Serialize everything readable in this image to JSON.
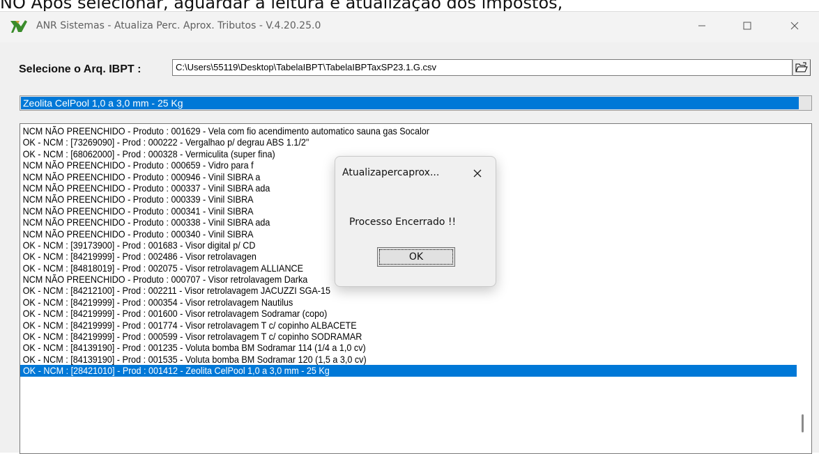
{
  "caption": "NO Após selecionar, aguardar a leitura e atualização dos impostos,",
  "window": {
    "title": "ANR Sistemas - Atualiza Perc. Aprox. Tributos - V.4.20.25.0",
    "minimize_icon": "minimize-icon",
    "maximize_icon": "maximize-icon",
    "close_icon": "close-icon"
  },
  "form": {
    "select_label": "Selecione o Arq. IBPT :",
    "path_value": "C:\\Users\\55119\\Desktop\\TabelaIBPT\\TabelaIBPTaxSP23.1.G.csv",
    "browse_icon": "folder-open-icon"
  },
  "progress": {
    "text": "Zeolita CelPool 1,0 a 3,0 mm - 25 Kg",
    "fraction": 0.985,
    "color": "#0078d7"
  },
  "log": {
    "items": [
      "NCM NÃO PREENCHIDO - Produto : 001629 - Vela com fio acendimento automatico sauna gas Socalor",
      "OK - NCM : [73269090] - Prod : 000222 - Vergalhao p/ degrau ABS 1.1/2\"",
      "OK - NCM : [68062000] - Prod : 000328 - Vermiculita (super fina)",
      "NCM NÃO PREENCHIDO - Produto : 000659 - Vidro para f",
      "NCM NÃO PREENCHIDO - Produto : 000946 - Vinil SIBRA                                                   a",
      "NCM NÃO PREENCHIDO - Produto : 000337 - Vinil SIBRA                                                   ada",
      "NCM NÃO PREENCHIDO - Produto : 000339 - Vinil SIBRA",
      "NCM NÃO PREENCHIDO - Produto : 000341 - Vinil SIBRA",
      "NCM NÃO PREENCHIDO - Produto : 000338 - Vinil SIBRA                                                   ada",
      "NCM NÃO PREENCHIDO - Produto : 000340 - Vinil SIBRA",
      "OK - NCM : [39173900] - Prod : 001683 - Visor digital p/ CD",
      "OK - NCM : [84219999] - Prod : 002486 - Visor retrolavagen",
      "OK - NCM : [84818019] - Prod : 002075 - Visor retrolavagem ALLIANCE",
      "NCM NÃO PREENCHIDO - Produto : 000707 - Visor retrolavagem Darka",
      "OK - NCM : [84212100] - Prod : 002211 - Visor retrolavagem JACUZZI SGA-15",
      "OK - NCM : [84219999] - Prod : 000354 - Visor retrolavagem Nautilus",
      "OK - NCM : [84219999] - Prod : 001600 - Visor retrolavagem Sodramar (copo)",
      "OK - NCM : [84219999] - Prod : 001774 - Visor retrolavagem T c/ copinho ALBACETE",
      "OK - NCM : [84219999] - Prod : 000599 - Visor retrolavagem T c/ copinho SODRAMAR",
      "OK - NCM : [84139190] - Prod : 001235 - Voluta bomba BM Sodramar 114 (1/4 a 1,0 cv)",
      "OK - NCM : [84139190] - Prod : 001535 - Voluta bomba BM Sodramar 120 (1,5 a 3,0 cv)",
      "OK - NCM : [28421010] - Prod : 001412 - Zeolita CelPool 1,0 a 3,0 mm - 25 Kg"
    ],
    "selected_color": "#0078d7"
  },
  "dialog": {
    "title": "Atualizapercaprox...",
    "message": "Processo Encerrado !!",
    "ok_label": "OK"
  }
}
